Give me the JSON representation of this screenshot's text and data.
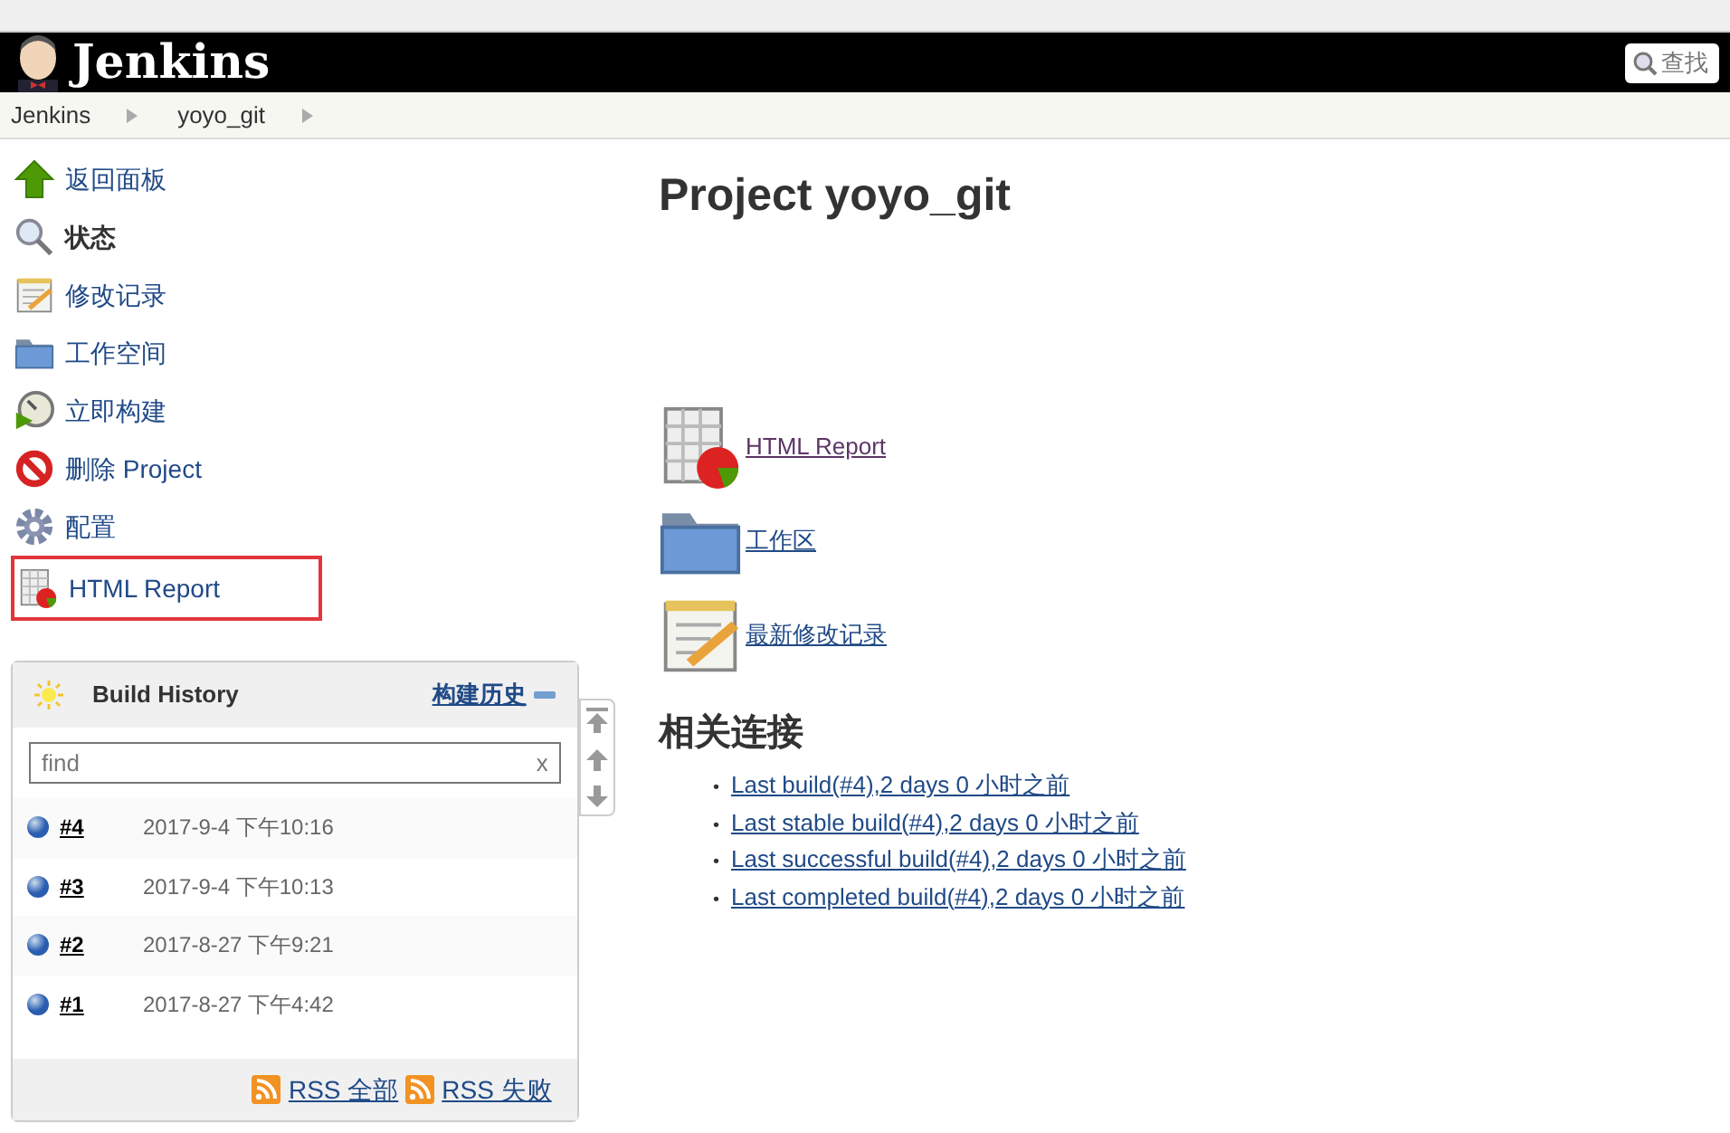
{
  "header": {
    "logo_text": "Jenkins",
    "search_placeholder": "查找"
  },
  "breadcrumbs": [
    "Jenkins",
    "yoyo_git"
  ],
  "sidebar": {
    "items": [
      {
        "label": "返回面板",
        "kind": "up",
        "current": false,
        "outlined": false
      },
      {
        "label": "状态",
        "kind": "status",
        "current": true,
        "outlined": false
      },
      {
        "label": "修改记录",
        "kind": "notepad",
        "current": false,
        "outlined": false
      },
      {
        "label": "工作空间",
        "kind": "folder",
        "current": false,
        "outlined": false
      },
      {
        "label": "立即构建",
        "kind": "clock",
        "current": false,
        "outlined": false
      },
      {
        "label": "删除 Project",
        "kind": "delete",
        "current": false,
        "outlined": false
      },
      {
        "label": "配置",
        "kind": "gear",
        "current": false,
        "outlined": false
      },
      {
        "label": "HTML Report",
        "kind": "report",
        "current": false,
        "outlined": true
      }
    ]
  },
  "build_history": {
    "title": "Build History",
    "trend_link": "构建历史",
    "search_placeholder": "find",
    "clear": "x",
    "builds": [
      {
        "number": "#4",
        "time": "2017-9-4 下午10:16"
      },
      {
        "number": "#3",
        "time": "2017-9-4 下午10:13"
      },
      {
        "number": "#2",
        "time": "2017-8-27 下午9:21"
      },
      {
        "number": "#1",
        "time": "2017-8-27 下午4:42"
      }
    ],
    "rss": [
      "RSS 全部",
      "RSS 失败"
    ]
  },
  "main": {
    "title": "Project yoyo_git",
    "links": [
      {
        "label": "HTML Report",
        "kind": "report",
        "visited": true
      },
      {
        "label": "工作区",
        "kind": "folder",
        "visited": false
      },
      {
        "label": "最新修改记录",
        "kind": "notepad",
        "visited": false
      }
    ],
    "permalinks_title": "相关连接",
    "permalinks": [
      {
        "bullet": "•",
        "label": "Last build(#4),2 days 0 小时之前"
      },
      {
        "bullet": "•",
        "label": "Last stable build(#4),2 days 0 小时之前"
      },
      {
        "bullet": "•",
        "label": "Last successful build(#4),2 days 0 小时之前"
      },
      {
        "bullet": "•",
        "label": "Last completed build(#4),2 days 0 小时之前"
      }
    ]
  }
}
